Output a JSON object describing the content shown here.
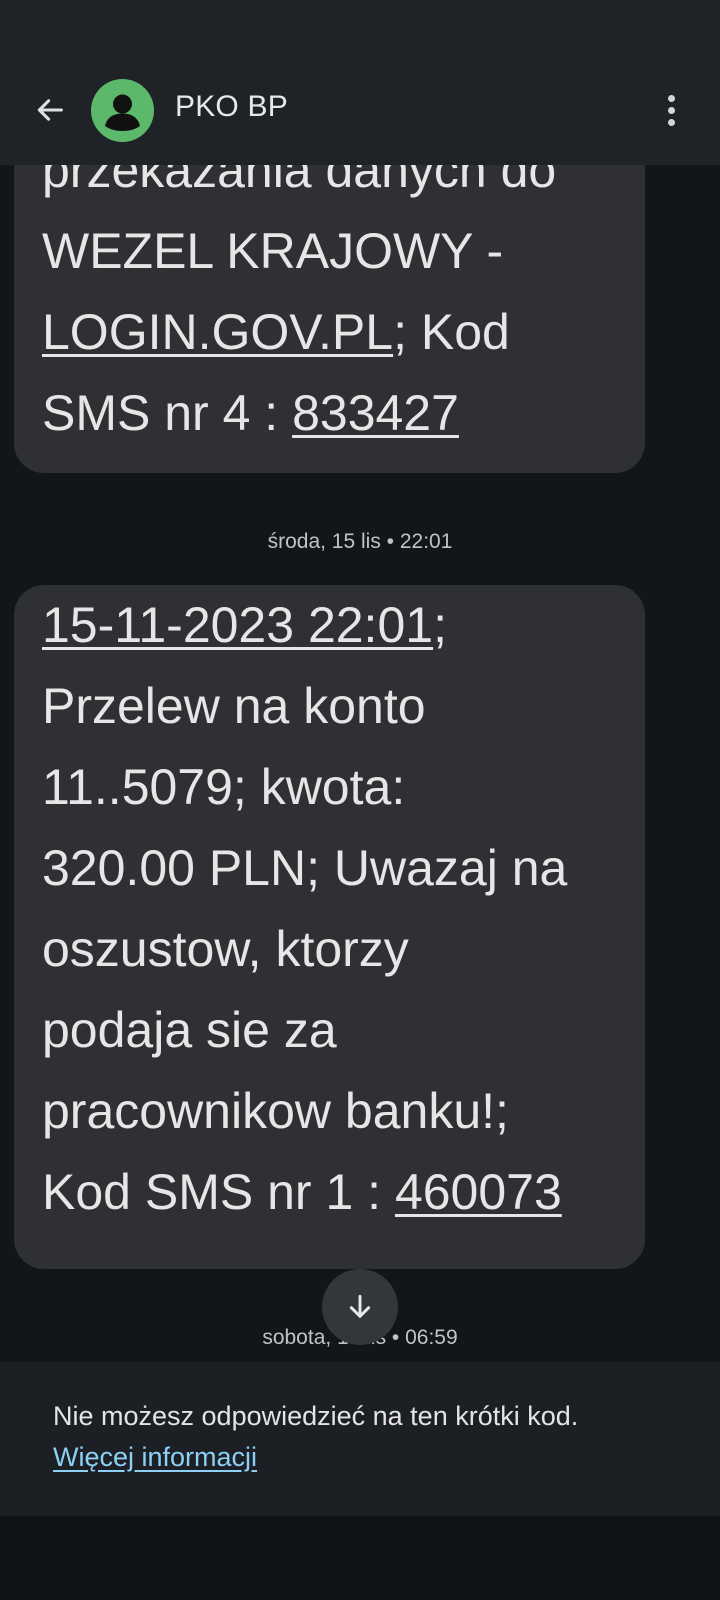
{
  "header": {
    "title": "PKO BP",
    "back_icon": "arrow-back-icon",
    "avatar_icon": "person-icon",
    "menu_icon": "more-vert-icon"
  },
  "messages": [
    {
      "lines": [
        {
          "parts": [
            {
              "text": "przekazania danych do",
              "underline": false
            }
          ]
        },
        {
          "parts": [
            {
              "text": "WEZEL KRAJOWY -",
              "underline": false
            }
          ]
        },
        {
          "parts": [
            {
              "text": "LOGIN.GOV.PL",
              "underline": true
            },
            {
              "text": "; Kod",
              "underline": false
            }
          ]
        },
        {
          "parts": [
            {
              "text": "SMS nr 4 : ",
              "underline": false
            },
            {
              "text": "833427",
              "underline": true
            }
          ]
        }
      ]
    },
    {
      "lines": [
        {
          "parts": [
            {
              "text": "15-11-2023 22:01",
              "underline": true
            },
            {
              "text": ";",
              "underline": false
            }
          ]
        },
        {
          "parts": [
            {
              "text": "Przelew na konto",
              "underline": false
            }
          ]
        },
        {
          "parts": [
            {
              "text": "11..5079; kwota:",
              "underline": false
            }
          ]
        },
        {
          "parts": [
            {
              "text": "320.00 PLN; Uwazaj na",
              "underline": false
            }
          ]
        },
        {
          "parts": [
            {
              "text": "oszustow, ktorzy",
              "underline": false
            }
          ]
        },
        {
          "parts": [
            {
              "text": "podaja sie za",
              "underline": false
            }
          ]
        },
        {
          "parts": [
            {
              "text": "pracownikow banku!;",
              "underline": false
            }
          ]
        },
        {
          "parts": [
            {
              "text": "Kod SMS nr 1 : ",
              "underline": false
            },
            {
              "text": "460073",
              "underline": true
            }
          ]
        }
      ]
    }
  ],
  "timestamps": {
    "first": "środa, 15 lis • 22:01",
    "second": "sobota, 18 lis • 06:59"
  },
  "scroll_button": {
    "icon": "arrow-down-icon"
  },
  "footer": {
    "text": "Nie możesz odpowiedzieć na ten krótki kod.",
    "link": "Więcej informacji"
  },
  "colors": {
    "background": "#11161b",
    "bubble": "#2e3033",
    "avatar": "#5cb86a",
    "link": "#8ecff5"
  }
}
